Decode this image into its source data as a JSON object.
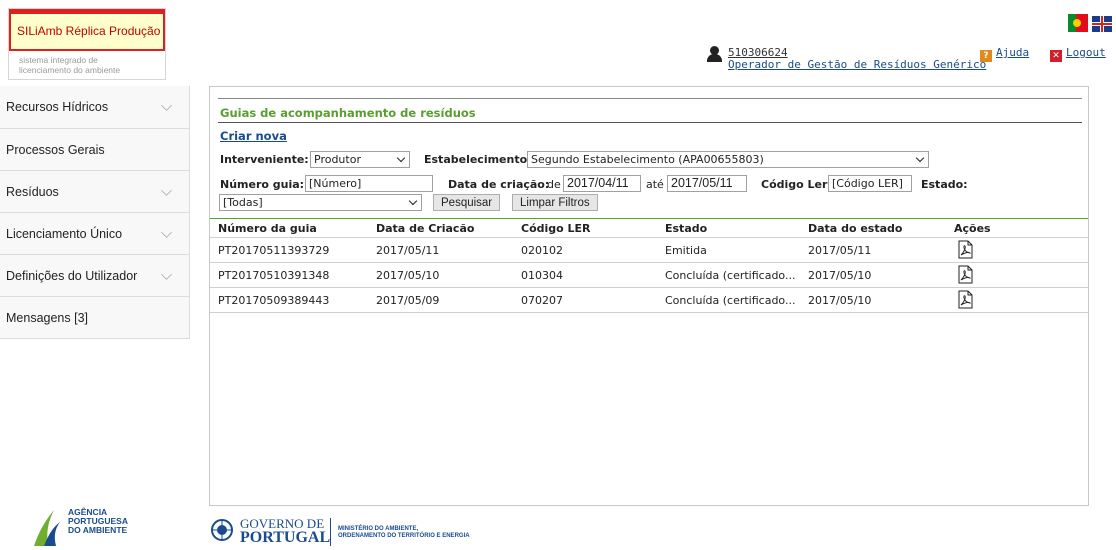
{
  "header": {
    "app_title": "SILiAmb Réplica Produção",
    "subtitle_line1": "sistema integrado de",
    "subtitle_line2": "licenciamento do ambiente",
    "user_id": "510306624",
    "user_role": "Operador de Gestão de Resíduos Genérico",
    "help_label": "Ajuda",
    "logout_label": "Logout",
    "languages": [
      "pt-flag-icon",
      "uk-flag-icon"
    ]
  },
  "sidebar": {
    "items": [
      {
        "label": "Recursos Hídricos",
        "expandable": true
      },
      {
        "label": "Processos Gerais",
        "expandable": false
      },
      {
        "label": "Resíduos",
        "expandable": true
      },
      {
        "label": "Licenciamento Único",
        "expandable": true
      },
      {
        "label": "Definições do Utilizador",
        "expandable": true
      },
      {
        "label": "Mensagens [3]",
        "expandable": false
      }
    ]
  },
  "main": {
    "section_title": "Guias de acompanhamento de resíduos",
    "create_link": "Criar nova",
    "filters": {
      "interveniente_label": "Interveniente:",
      "interveniente_value": "Produtor",
      "estabelecimento_label": "Estabelecimento:",
      "estabelecimento_value": "Segundo Estabelecimento (APA00655803)",
      "numero_label": "Número guia:",
      "numero_placeholder": "[Número]",
      "data_label": "Data de criação:",
      "data_de_label": "de",
      "data_from": "2017/04/11",
      "data_ate_label": "até",
      "data_to": "2017/05/11",
      "codigo_label": "Código Ler:",
      "codigo_placeholder": "[Código LER]",
      "estado_label": "Estado:",
      "estado_value": "[Todas]",
      "search_button": "Pesquisar",
      "clear_button": "Limpar Filtros"
    },
    "table": {
      "columns": [
        "Número da guia",
        "Data de Criacão",
        "Código LER",
        "Estado",
        "Data do estado",
        "Ações"
      ],
      "rows": [
        {
          "numero": "PT20170511393729",
          "data_criacao": "2017/05/11",
          "codigo": "020102",
          "estado": "Emitida",
          "data_estado": "2017/05/11",
          "action_icon": "pdf-icon"
        },
        {
          "numero": "PT20170510391348",
          "data_criacao": "2017/05/10",
          "codigo": "010304",
          "estado": "Concluída (certificado...",
          "data_estado": "2017/05/10",
          "action_icon": "pdf-icon"
        },
        {
          "numero": "PT20170509389443",
          "data_criacao": "2017/05/09",
          "codigo": "070207",
          "estado": "Concluída (certificado...",
          "data_estado": "2017/05/10",
          "action_icon": "pdf-icon"
        }
      ]
    }
  },
  "footer": {
    "apa_line1": "AGÊNCIA",
    "apa_line2": "PORTUGUESA",
    "apa_line3": "DO AMBIENTE",
    "gov_line1": "GOVERNO DE",
    "gov_line2": "PORTUGAL",
    "ministry_line1": "MINISTÉRIO DO AMBIENTE,",
    "ministry_line2": "ORDENAMENTO DO TERRITÓRIO E ENERGIA"
  },
  "colors": {
    "accent_green": "#5a9e2f",
    "link_blue": "#1a4b8c",
    "brand_red": "#e02020",
    "brand_bg": "#ffffcc"
  }
}
